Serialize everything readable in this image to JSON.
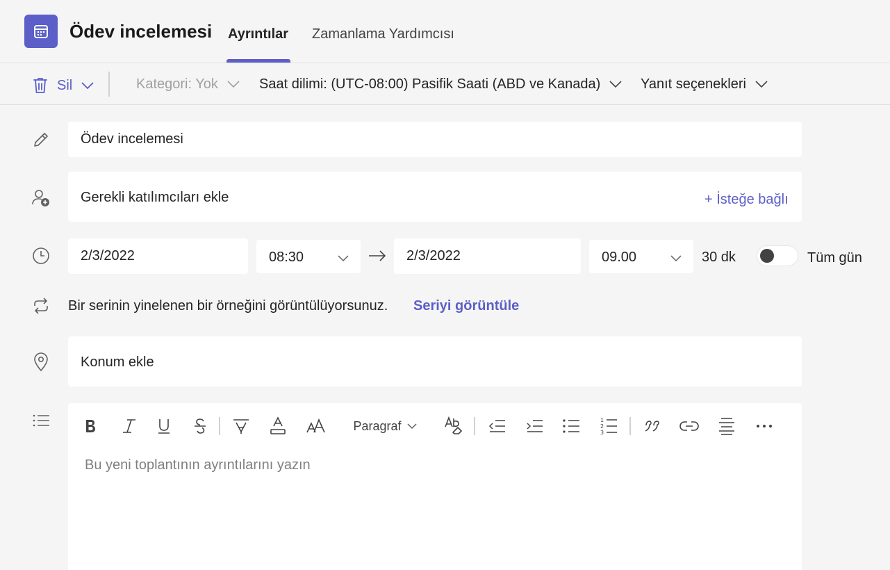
{
  "header": {
    "title": "Ödev incelemesi",
    "tabs": [
      {
        "label": "Ayrıntılar",
        "active": true
      },
      {
        "label": "Zamanlama Yardımcısı",
        "active": false
      }
    ],
    "icon": "calendar-icon"
  },
  "toolbar": {
    "delete_label": "Sil",
    "category_label": "Kategori: Yok",
    "timezone_label": "Saat dilimi: (UTC-08:00) Pasifik Saati (ABD ve Kanada)",
    "response_label": "Yanıt seçenekleri"
  },
  "form": {
    "title_value": "Ödev incelemesi",
    "attendees_placeholder": "Gerekli katılımcıları ekle",
    "optional_link": "+ İsteğe bağlı",
    "start_date": "2/3/2022",
    "start_time": "08:30",
    "end_date": "2/3/2022",
    "end_time": "09.00",
    "duration": "30 dk",
    "all_day_label": "Tüm gün",
    "all_day_on": false,
    "recurrence_text": "Bir serinin yinelenen bir örneğini görüntülüyorsunuz.",
    "recurrence_link": "Seriyi görüntüle",
    "location_placeholder": "Konum ekle",
    "details_placeholder": "Bu yeni toplantının ayrıntılarını yazın"
  },
  "editor_toolbar": {
    "paragraph_label": "Paragraf"
  },
  "colors": {
    "accent": "#5b5fc7",
    "background": "#f5f5f5",
    "field": "#ffffff",
    "muted": "#a0a0a0"
  }
}
